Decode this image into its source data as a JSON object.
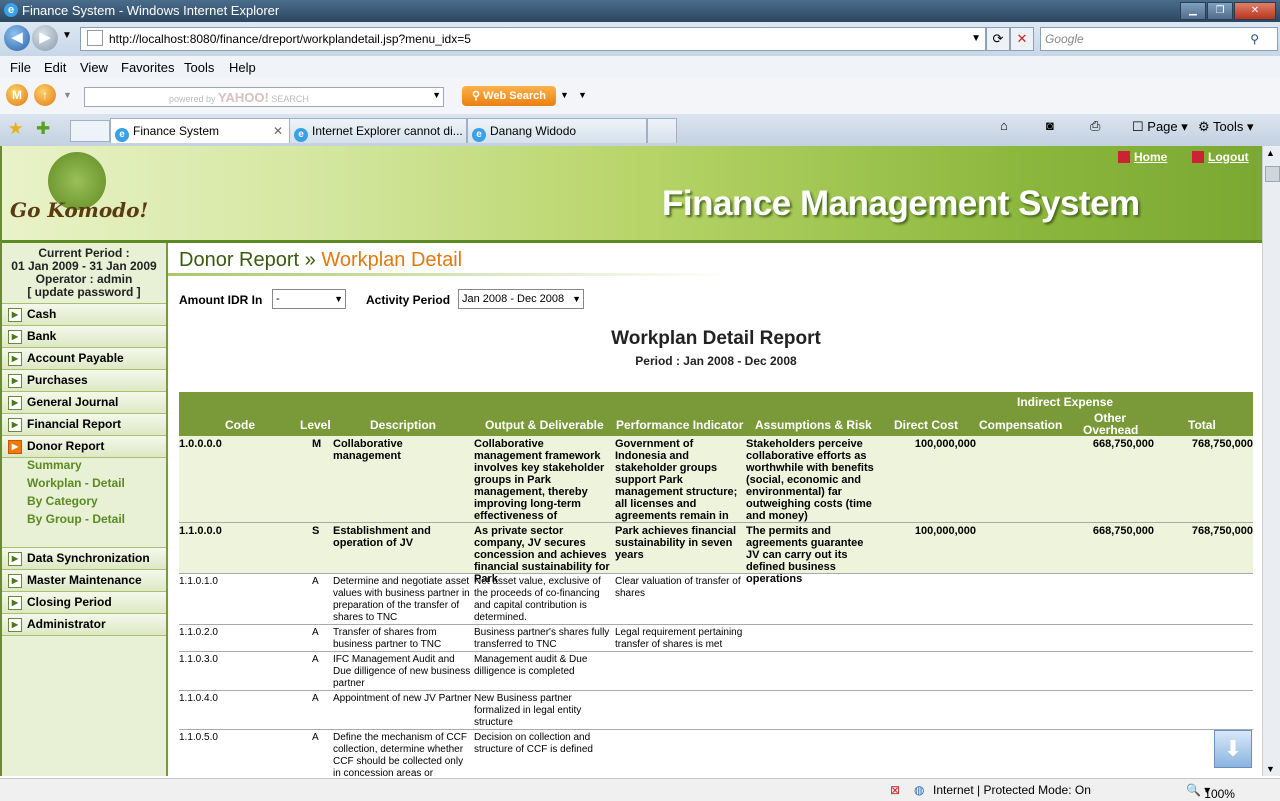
{
  "window": {
    "title": "Finance System - Windows Internet Explorer"
  },
  "browser": {
    "url": "http://localhost:8080/finance/dreport/workplandetail.jsp?menu_idx=5",
    "search_placeholder": "Google",
    "menu": [
      "File",
      "Edit",
      "View",
      "Favorites",
      "Tools",
      "Help"
    ],
    "yahoo_powered": "powered by",
    "yahoo_brand": "YAHOO!",
    "yahoo_search": "SEARCH",
    "web_search": "Web Search",
    "tabs": [
      "Finance System",
      "Internet Explorer cannot di...",
      "Danang Widodo"
    ],
    "page_label": "Page",
    "tools_label": "Tools",
    "status": "Internet | Protected Mode: On",
    "zoom": "100%"
  },
  "banner": {
    "title": "Finance Management System",
    "logo_text": "Go Komodo!",
    "home": "Home",
    "logout": "Logout"
  },
  "sidebar": {
    "period_label": "Current Period :",
    "period_value": "01 Jan 2009 - 31 Jan 2009",
    "operator": "Operator : admin",
    "update_password": "[ update password ]",
    "menu": [
      "Cash",
      "Bank",
      "Account Payable",
      "Purchases",
      "General Journal",
      "Financial Report",
      "Donor Report"
    ],
    "submenu": [
      "Summary",
      "Workplan - Detail",
      "By Category",
      "By Group - Detail"
    ],
    "menu2": [
      "Data Synchronization",
      "Master Maintenance",
      "Closing Period",
      "Administrator"
    ]
  },
  "main": {
    "breadcrumb_parent": "Donor Report",
    "breadcrumb_sep": " » ",
    "breadcrumb_current": "Workplan Detail",
    "amount_label": "Amount IDR In",
    "amount_value": "-",
    "activity_label": "Activity Period",
    "activity_value": "Jan 2008 - Dec 2008",
    "report_title": "Workplan Detail Report",
    "report_period": "Period : Jan 2008 - Dec 2008"
  },
  "table": {
    "headers": {
      "code": "Code",
      "level": "Level",
      "description": "Description",
      "output": "Output & Deliverable",
      "indicator": "Performance Indicator",
      "assumptions": "Assumptions & Risk",
      "direct": "Direct Cost",
      "indirect": "Indirect Expense",
      "compensation": "Compensation",
      "other": "Other Overhead",
      "total": "Total"
    },
    "rows": [
      {
        "code": "1.0.0.0.0",
        "level": "M",
        "desc": "Collaborative management",
        "output": "Collaborative management framework involves key stakeholder groups in Park management, thereby improving long-term effectiveness of professional management",
        "indicator": "Government of Indonesia and stakeholder groups support Park management structure; all licenses and agreements remain in full force",
        "assumptions": "Stakeholders perceive collaborative efforts as worthwhile with benefits (social, economic and environmental) far outweighing costs (time and money)",
        "direct": "100,000,000",
        "other": "668,750,000",
        "total": "768,750,000"
      },
      {
        "code": "1.1.0.0.0",
        "level": "S",
        "desc": "Establishment and operation of JV",
        "output": "As private sector company, JV secures concession and achieves financial sustainability for Park",
        "indicator": "Park achieves financial sustainability in seven years",
        "assumptions": "The permits and agreements guarantee JV can carry out its defined business operations",
        "direct": "100,000,000",
        "other": "668,750,000",
        "total": "768,750,000"
      },
      {
        "code": "1.1.0.1.0",
        "level": "A",
        "desc": "Determine and negotiate asset values with business partner in preparation of the transfer of shares to TNC",
        "output": "Net asset value, exclusive of the proceeds of co-financing and capital contribution is determined.",
        "indicator": "Clear valuation of transfer of shares",
        "assumptions": "",
        "direct": "",
        "other": "",
        "total": ""
      },
      {
        "code": "1.1.0.2.0",
        "level": "A",
        "desc": "Transfer of shares from business partner to TNC",
        "output": "Business partner's shares fully transferred to TNC",
        "indicator": "Legal requirement pertaining transfer of shares is met",
        "assumptions": "",
        "direct": "",
        "other": "",
        "total": ""
      },
      {
        "code": "1.1.0.3.0",
        "level": "A",
        "desc": "IFC Management Audit and Due dilligence of new business partner",
        "output": "Management audit & Due dilligence is completed",
        "indicator": "",
        "assumptions": "",
        "direct": "",
        "other": "",
        "total": ""
      },
      {
        "code": "1.1.0.4.0",
        "level": "A",
        "desc": "Appointment of new JV Partner",
        "output": "New Business partner formalized in legal entity structure",
        "indicator": "",
        "assumptions": "",
        "direct": "",
        "other": "",
        "total": ""
      },
      {
        "code": "1.1.0.5.0",
        "level": "A",
        "desc": "Define the mechanism of CCF collection, determine whether CCF should be collected only in concession areas or",
        "output": "Decision on collection and structure of CCF is defined",
        "indicator": "",
        "assumptions": "",
        "direct": "",
        "other": "",
        "total": ""
      }
    ]
  }
}
